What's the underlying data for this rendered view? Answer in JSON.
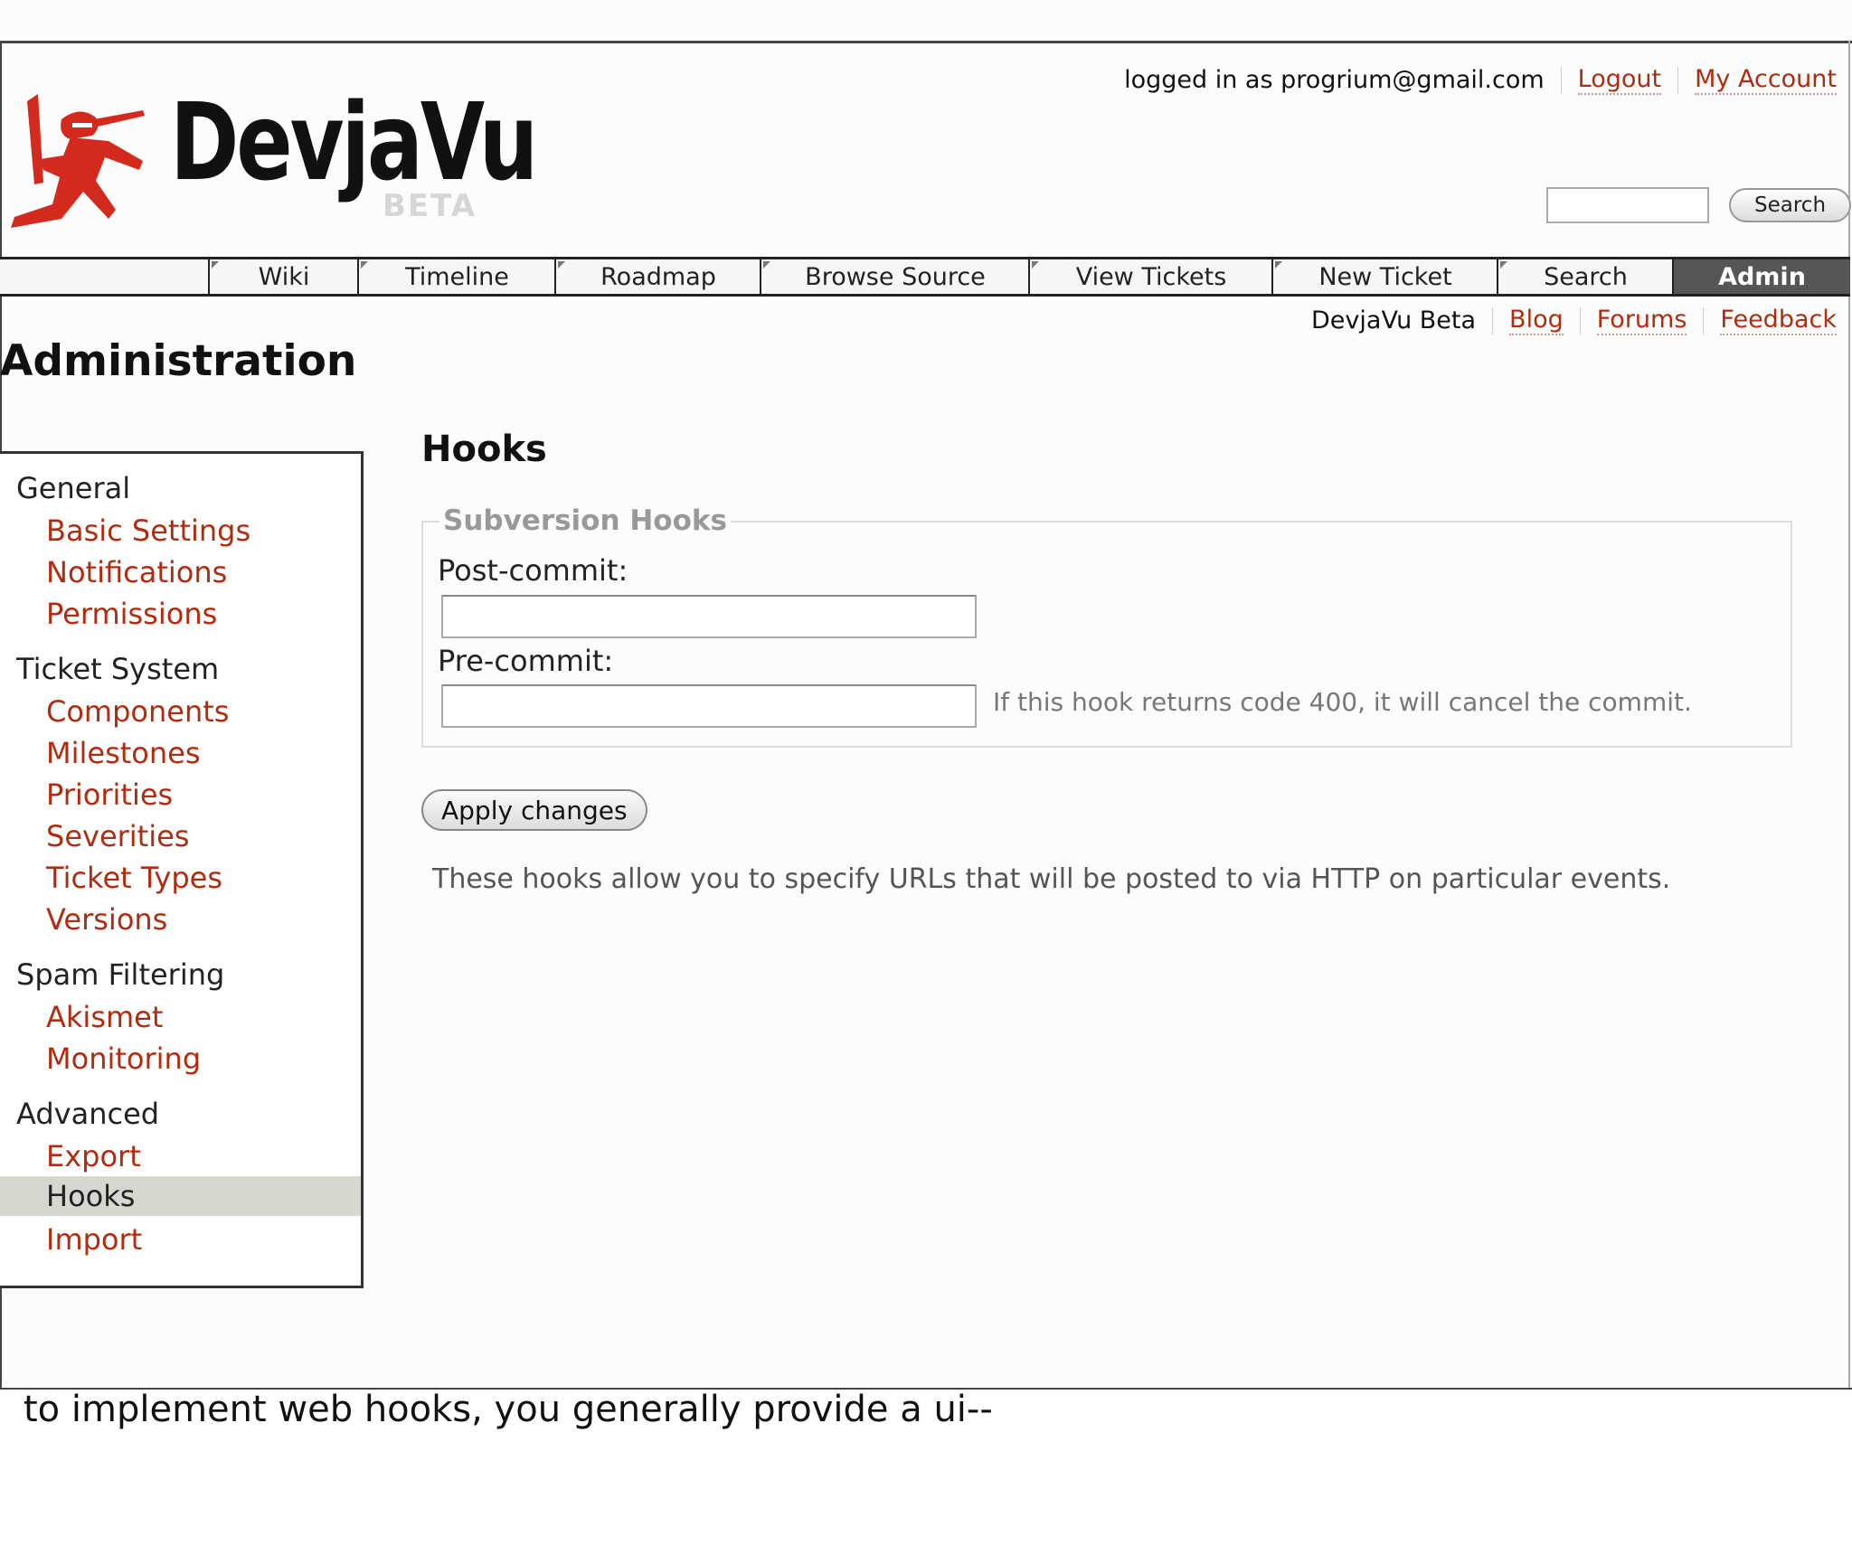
{
  "logo": {
    "word": "DevjaVu",
    "badge": "BETA"
  },
  "meta_nav": {
    "logged_in": "logged in as progrium@gmail.com",
    "logout": "Logout",
    "account": "My Account"
  },
  "top_search": {
    "input_value": "",
    "button": "Search"
  },
  "main_nav": {
    "tabs": [
      "Wiki",
      "Timeline",
      "Roadmap",
      "Browse Source",
      "View Tickets",
      "New Ticket",
      "Search",
      "Admin"
    ],
    "active": "Admin"
  },
  "sub_nav": {
    "items": [
      "DevjaVu Beta",
      "Blog",
      "Forums",
      "Feedback"
    ]
  },
  "page": {
    "title": "Administration"
  },
  "sidebar": {
    "groups": [
      {
        "label": "General",
        "items": [
          "Basic Settings",
          "Notifications",
          "Permissions"
        ]
      },
      {
        "label": "Ticket System",
        "items": [
          "Components",
          "Milestones",
          "Priorities",
          "Severities",
          "Ticket Types",
          "Versions"
        ]
      },
      {
        "label": "Spam Filtering",
        "items": [
          "Akismet",
          "Monitoring"
        ]
      },
      {
        "label": "Advanced",
        "items": [
          "Export",
          "Hooks",
          "Import"
        ]
      }
    ],
    "active_item": "Hooks"
  },
  "content": {
    "title": "Hooks",
    "fieldset_legend": "Subversion Hooks",
    "post_commit": {
      "label": "Post-commit:",
      "value": ""
    },
    "pre_commit": {
      "label": "Pre-commit:",
      "value": "",
      "hint": "If this hook returns code 400, it will cancel the commit."
    },
    "apply_button": "Apply changes",
    "help_text": "These hooks allow you to specify URLs that will be posted to via HTTP on particular events."
  },
  "caption": "to implement web hooks, you generally provide a ui--",
  "colors": {
    "link": "#b02c10",
    "active_tab": "#565656",
    "active_sidebar": "#d7d7cf",
    "logo_red": "#d42a1e"
  }
}
